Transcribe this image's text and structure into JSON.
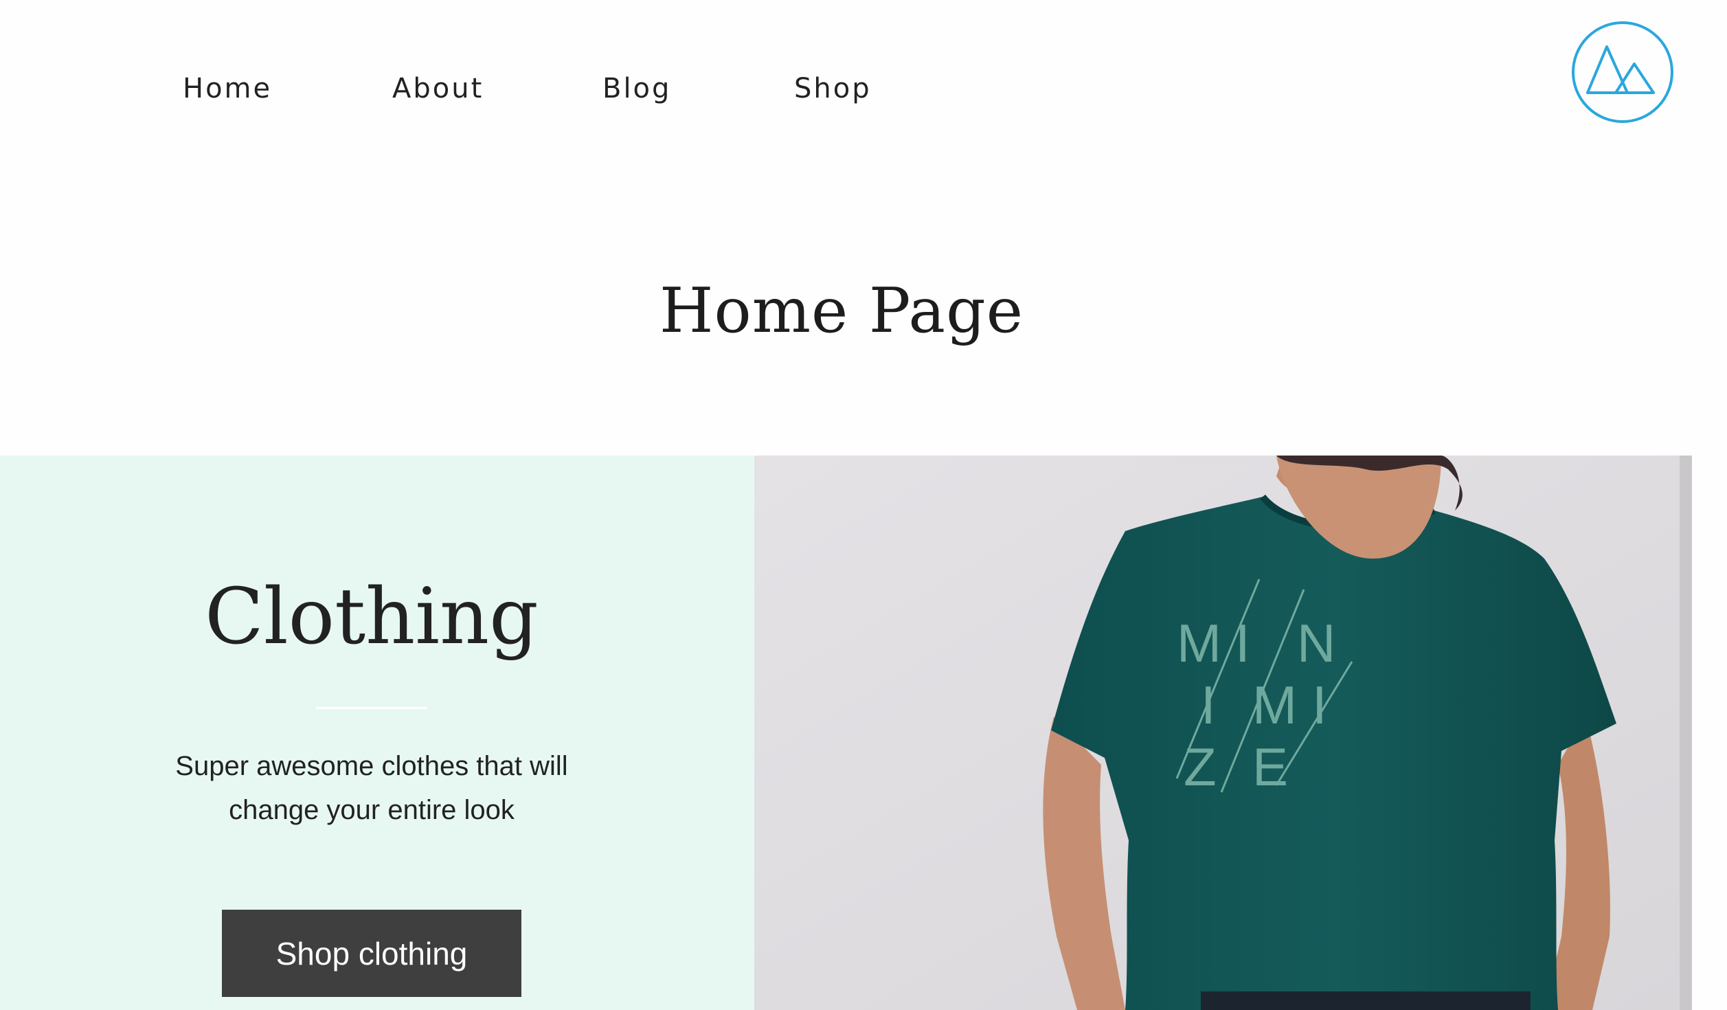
{
  "nav": {
    "items": [
      {
        "label": "Home"
      },
      {
        "label": "About"
      },
      {
        "label": "Blog"
      },
      {
        "label": "Shop"
      }
    ],
    "logo_icon": "mountain-logo-icon",
    "accent_color": "#2aa7dd"
  },
  "page": {
    "title": "Home Page"
  },
  "hero": {
    "heading": "Clothing",
    "description": "Super awesome clothes that will change your entire look",
    "button_label": "Shop clothing",
    "panel_color": "#e7f8f3",
    "button_color": "#3f3f3f",
    "image": {
      "subject": "man-in-teal-tshirt-photo",
      "shirt_text": [
        "M",
        "I",
        "N",
        "I",
        "M",
        "I",
        "Z",
        "E"
      ]
    }
  }
}
